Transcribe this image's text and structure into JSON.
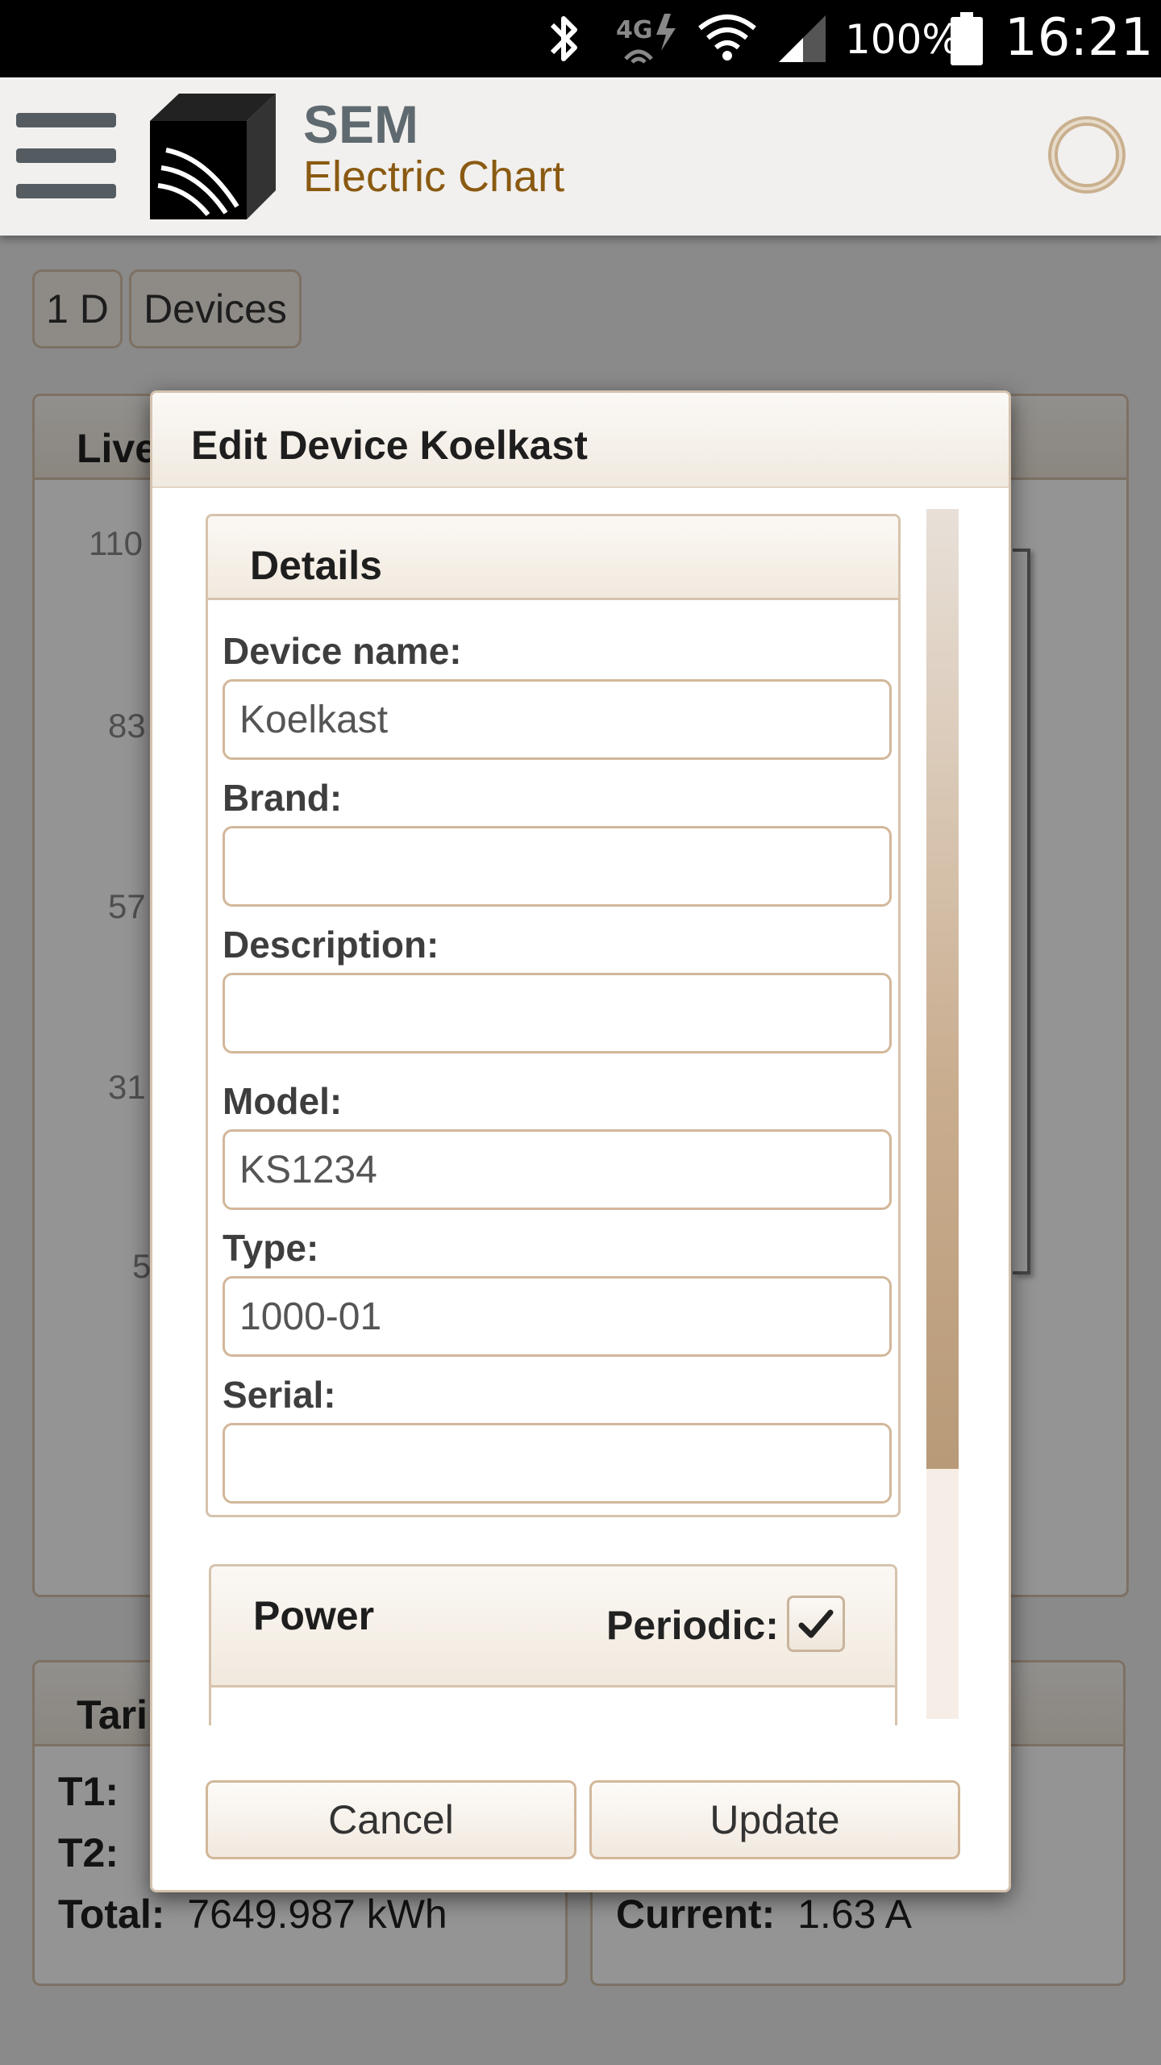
{
  "status_bar": {
    "battery_percent": "100%",
    "clock": "16:21",
    "network_label": "4G",
    "icons": [
      "bluetooth-icon",
      "4g-data-icon",
      "wifi-icon",
      "cell-signal-icon",
      "battery-icon"
    ]
  },
  "header": {
    "title": "SEM",
    "subtitle": "Electric Chart",
    "icons": [
      "menu-icon",
      "cube-logo-icon",
      "refresh-ring-icon"
    ]
  },
  "toolbar": {
    "range_label": "1 D",
    "devices_label": "Devices"
  },
  "live_panel": {
    "title_visible": "Live",
    "y_ticks_visible": [
      "110",
      "83",
      "57",
      "31",
      "5"
    ]
  },
  "tariff_panel": {
    "title_visible": "Tari",
    "t1_label": "T1:",
    "t2_label": "T2:",
    "total_label": "Total:",
    "total_value": "7649.987 kWh"
  },
  "current_panel": {
    "current_label": "Current:",
    "current_value": "1.63 A"
  },
  "dialog": {
    "title": "Edit Device Koelkast",
    "details_section": {
      "title": "Details",
      "fields": [
        {
          "label": "Device name:",
          "value": "Koelkast"
        },
        {
          "label": "Brand:",
          "value": ""
        },
        {
          "label": "Description:",
          "value": ""
        },
        {
          "label": "Model:",
          "value": "KS1234"
        },
        {
          "label": "Type:",
          "value": "1000-01"
        },
        {
          "label": "Serial:",
          "value": ""
        }
      ]
    },
    "power_section": {
      "title": "Power",
      "periodic_label": "Periodic:",
      "periodic_checked": true
    },
    "cancel_label": "Cancel",
    "update_label": "Update"
  },
  "colors": {
    "accent_brown": "#8a5a12",
    "border_tan": "#d2b79a",
    "header_grey": "#5f6a70"
  }
}
